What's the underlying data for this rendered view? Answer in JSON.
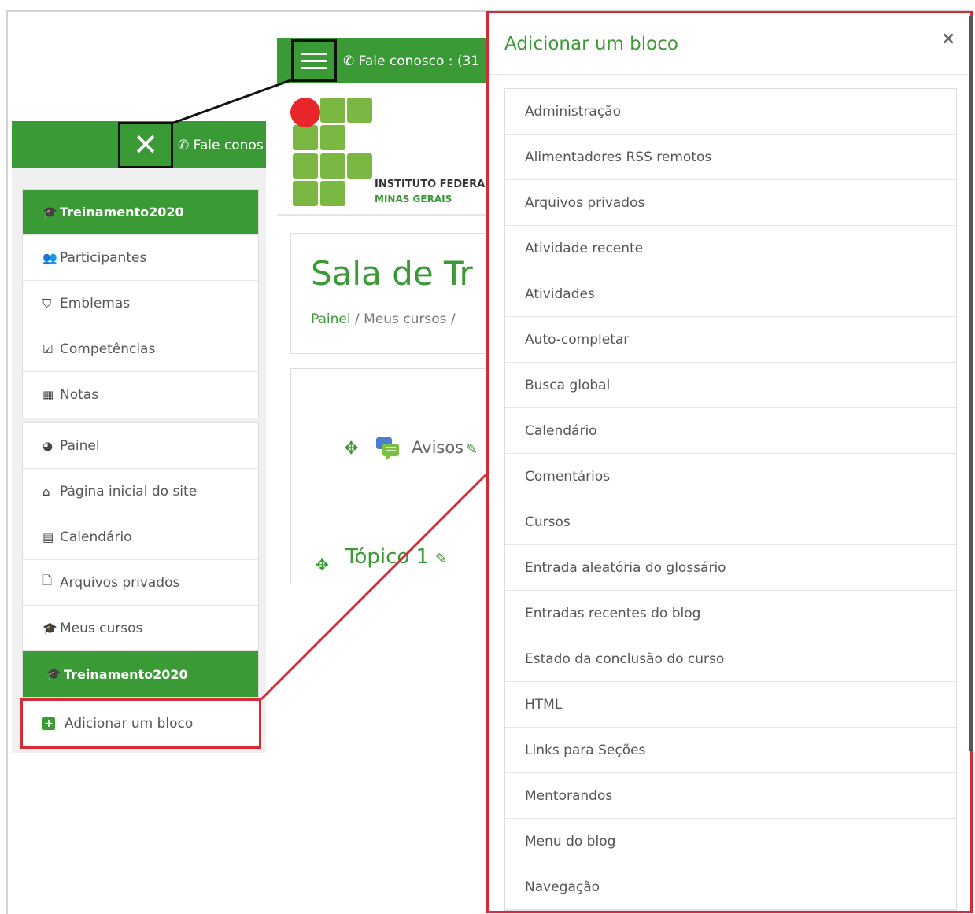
{
  "header": {
    "phone_top": "Fale conosco : (31",
    "phone_left": "Fale conos"
  },
  "logo": {
    "line1": "INSTITUTO FEDERAL",
    "line2": "MINAS GERAIS"
  },
  "course": {
    "title": "Sala de Tr",
    "breadcrumb": [
      "Painel",
      "/",
      "Meus cursos",
      "/"
    ]
  },
  "content": {
    "activity": "Avisos",
    "topic": "Tópico 1"
  },
  "drawer": {
    "course_header": "Treinamento2020",
    "course_items": [
      {
        "icon": "users-icon",
        "label": "Participantes"
      },
      {
        "icon": "shield-icon",
        "label": "Emblemas"
      },
      {
        "icon": "check-square-icon",
        "label": "Competências"
      },
      {
        "icon": "table-icon",
        "label": "Notas"
      }
    ],
    "site_items": [
      {
        "icon": "dashboard-icon",
        "label": "Painel"
      },
      {
        "icon": "home-icon",
        "label": "Página inicial do site"
      },
      {
        "icon": "calendar-icon",
        "label": "Calendário"
      },
      {
        "icon": "file-icon",
        "label": "Arquivos privados"
      },
      {
        "icon": "graduation-cap-icon",
        "label": "Meus cursos"
      }
    ],
    "footer_header": "Treinamento2020",
    "add_block": "Adicionar um bloco"
  },
  "modal": {
    "title": "Adicionar um bloco",
    "close": "×",
    "items": [
      "Administração",
      "Alimentadores RSS remotos",
      "Arquivos privados",
      "Atividade recente",
      "Atividades",
      "Auto-completar",
      "Busca global",
      "Calendário",
      "Comentários",
      "Cursos",
      "Entrada aleatória do glossário",
      "Entradas recentes do blog",
      "Estado da conclusão do curso",
      "HTML",
      "Links para Seções",
      "Mentorandos",
      "Menu do blog",
      "Navegação"
    ]
  },
  "colors": {
    "brand_green": "#3a9a35",
    "highlight_red": "#d52b36",
    "logo_green": "#7bb843",
    "logo_red": "#e8262b"
  }
}
